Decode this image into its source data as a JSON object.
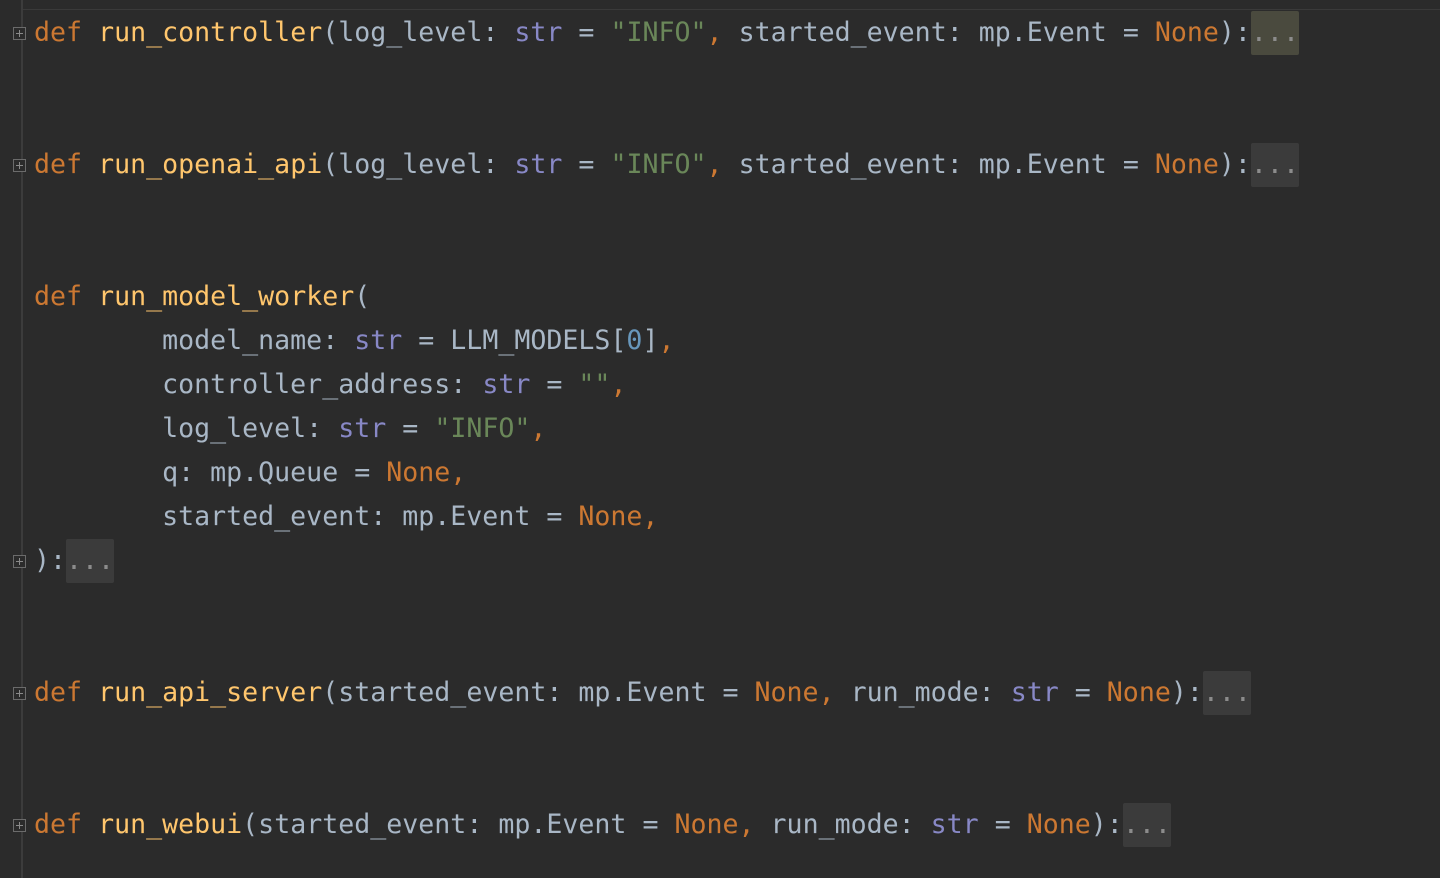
{
  "editor": {
    "background": "#2b2b2b",
    "colors": {
      "keyword": "#cc7832",
      "function": "#ffc66d",
      "plain": "#a9b7c6",
      "builtin": "#8888c6",
      "string": "#6a8759",
      "number": "#6897bb",
      "folded_bg": "#3b3b3b"
    },
    "lines": [
      {
        "fold": true,
        "tokens": [
          {
            "t": "def",
            "c": "kw"
          },
          {
            "t": " ",
            "c": "pl"
          },
          {
            "t": "run_controller",
            "c": "fn"
          },
          {
            "t": "(log_level: ",
            "c": "pl"
          },
          {
            "t": "str",
            "c": "bi"
          },
          {
            "t": " = ",
            "c": "pl"
          },
          {
            "t": "\"INFO\"",
            "c": "st"
          },
          {
            "t": ", ",
            "c": "cm"
          },
          {
            "t": "started_event: mp.Event = ",
            "c": "pl"
          },
          {
            "t": "None",
            "c": "kw"
          },
          {
            "t": "):",
            "c": "pl"
          },
          {
            "t": "...",
            "c": "folded-active"
          }
        ]
      },
      {
        "fold": true,
        "tokens": [
          {
            "t": "def",
            "c": "kw"
          },
          {
            "t": " ",
            "c": "pl"
          },
          {
            "t": "run_openai_api",
            "c": "fn"
          },
          {
            "t": "(log_level: ",
            "c": "pl"
          },
          {
            "t": "str",
            "c": "bi"
          },
          {
            "t": " = ",
            "c": "pl"
          },
          {
            "t": "\"INFO\"",
            "c": "st"
          },
          {
            "t": ", ",
            "c": "cm"
          },
          {
            "t": "started_event: mp.Event = ",
            "c": "pl"
          },
          {
            "t": "None",
            "c": "kw"
          },
          {
            "t": "):",
            "c": "pl"
          },
          {
            "t": "...",
            "c": "folded"
          }
        ]
      },
      {
        "fold": false,
        "tokens": [
          {
            "t": "def",
            "c": "kw"
          },
          {
            "t": " ",
            "c": "pl"
          },
          {
            "t": "run_model_worker",
            "c": "fn"
          },
          {
            "t": "(",
            "c": "pl"
          }
        ]
      },
      {
        "fold": false,
        "tokens": [
          {
            "t": "        model_name: ",
            "c": "pl"
          },
          {
            "t": "str",
            "c": "bi"
          },
          {
            "t": " = LLM_MODELS[",
            "c": "pl"
          },
          {
            "t": "0",
            "c": "nu"
          },
          {
            "t": "]",
            "c": "pl"
          },
          {
            "t": ",",
            "c": "cm"
          }
        ]
      },
      {
        "fold": false,
        "tokens": [
          {
            "t": "        controller_address: ",
            "c": "pl"
          },
          {
            "t": "str",
            "c": "bi"
          },
          {
            "t": " = ",
            "c": "pl"
          },
          {
            "t": "\"\"",
            "c": "st"
          },
          {
            "t": ",",
            "c": "cm"
          }
        ]
      },
      {
        "fold": false,
        "tokens": [
          {
            "t": "        log_level: ",
            "c": "pl"
          },
          {
            "t": "str",
            "c": "bi"
          },
          {
            "t": " = ",
            "c": "pl"
          },
          {
            "t": "\"INFO\"",
            "c": "st"
          },
          {
            "t": ",",
            "c": "cm"
          }
        ]
      },
      {
        "fold": false,
        "tokens": [
          {
            "t": "        q: mp.Queue = ",
            "c": "pl"
          },
          {
            "t": "None",
            "c": "kw"
          },
          {
            "t": ",",
            "c": "cm"
          }
        ]
      },
      {
        "fold": false,
        "tokens": [
          {
            "t": "        started_event: mp.Event = ",
            "c": "pl"
          },
          {
            "t": "None",
            "c": "kw"
          },
          {
            "t": ",",
            "c": "cm"
          }
        ]
      },
      {
        "fold": true,
        "tokens": [
          {
            "t": "):",
            "c": "pl"
          },
          {
            "t": "...",
            "c": "folded"
          }
        ]
      },
      {
        "fold": true,
        "tokens": [
          {
            "t": "def",
            "c": "kw"
          },
          {
            "t": " ",
            "c": "pl"
          },
          {
            "t": "run_api_server",
            "c": "fn"
          },
          {
            "t": "(started_event: mp.Event = ",
            "c": "pl"
          },
          {
            "t": "None",
            "c": "kw"
          },
          {
            "t": ", ",
            "c": "cm"
          },
          {
            "t": "run_mode: ",
            "c": "pl"
          },
          {
            "t": "str",
            "c": "bi"
          },
          {
            "t": " = ",
            "c": "pl"
          },
          {
            "t": "None",
            "c": "kw"
          },
          {
            "t": "):",
            "c": "pl"
          },
          {
            "t": "...",
            "c": "folded"
          }
        ]
      },
      {
        "fold": true,
        "tokens": [
          {
            "t": "def",
            "c": "kw"
          },
          {
            "t": " ",
            "c": "pl"
          },
          {
            "t": "run_webui",
            "c": "fn"
          },
          {
            "t": "(started_event: mp.Event = ",
            "c": "pl"
          },
          {
            "t": "None",
            "c": "kw"
          },
          {
            "t": ", ",
            "c": "cm"
          },
          {
            "t": "run_mode: ",
            "c": "pl"
          },
          {
            "t": "str",
            "c": "bi"
          },
          {
            "t": " = ",
            "c": "pl"
          },
          {
            "t": "None",
            "c": "kw"
          },
          {
            "t": "):",
            "c": "pl"
          },
          {
            "t": "...",
            "c": "folded"
          }
        ]
      }
    ]
  }
}
